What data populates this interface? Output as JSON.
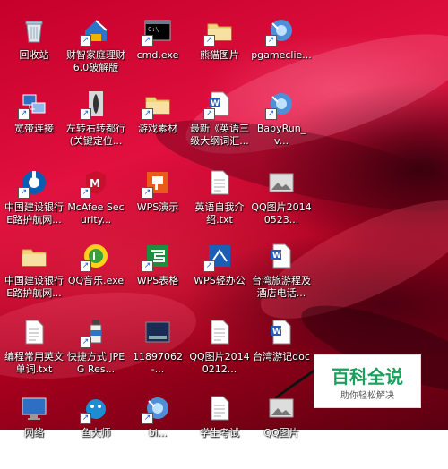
{
  "desktop": {
    "top_partial_label": "",
    "icons": [
      {
        "name": "recycle-bin",
        "icon": "recycle-bin-icon",
        "label": "回收站",
        "shortcut": false
      },
      {
        "name": "finance-software",
        "icon": "finance-house-icon",
        "label": "财智家庭理财6.0破解版",
        "shortcut": true
      },
      {
        "name": "cmd",
        "icon": "terminal-icon",
        "label": "cmd.exe",
        "shortcut": true
      },
      {
        "name": "panda-images",
        "icon": "folder-icon",
        "label": "熊猫图片",
        "shortcut": true
      },
      {
        "name": "pgameclient",
        "icon": "game-client-icon",
        "label": "pgameclie...",
        "shortcut": true
      },
      {
        "name": "broadband",
        "icon": "network-connection-icon",
        "label": "宽带连接",
        "shortcut": true
      },
      {
        "name": "left-right-game",
        "icon": "game-figure-icon",
        "label": "左转右转都行(关键定位...",
        "shortcut": true
      },
      {
        "name": "game-assets",
        "icon": "folder-icon",
        "label": "游戏素材",
        "shortcut": true
      },
      {
        "name": "latest-doc",
        "icon": "word-doc-icon",
        "label": "最新《英语三级大纲词汇...",
        "shortcut": true
      },
      {
        "name": "babyrun",
        "icon": "game-client-icon",
        "label": "BabyRun_v...",
        "shortcut": true
      },
      {
        "name": "ccb-guard",
        "icon": "ccb-bank-icon",
        "label": "中国建设银行E路护航网...",
        "shortcut": true
      },
      {
        "name": "mcafee",
        "icon": "mcafee-shield-icon",
        "label": "McAfee Security...",
        "shortcut": true
      },
      {
        "name": "wps-presentation",
        "icon": "wps-presentation-icon",
        "label": "WPS演示",
        "shortcut": true
      },
      {
        "name": "english-intro",
        "icon": "text-file-icon",
        "label": "英语自我介绍.txt",
        "shortcut": false
      },
      {
        "name": "qq-image-1",
        "icon": "image-file-icon",
        "label": "QQ图片20140523...",
        "shortcut": false
      },
      {
        "name": "ccb-folder",
        "icon": "folder-icon",
        "label": "中国建设银行E路护航网...",
        "shortcut": false
      },
      {
        "name": "qq-music",
        "icon": "qq-music-icon",
        "label": "QQ音乐.exe",
        "shortcut": true
      },
      {
        "name": "wps-spreadsheet",
        "icon": "wps-spreadsheet-icon",
        "label": "WPS表格",
        "shortcut": true
      },
      {
        "name": "wps-office",
        "icon": "wps-office-icon",
        "label": "WPS轻办公",
        "shortcut": true
      },
      {
        "name": "taiwan-travel",
        "icon": "word-doc-icon",
        "label": "台湾旅游程及酒店电话...",
        "shortcut": false
      },
      {
        "name": "english-words",
        "icon": "text-file-icon",
        "label": "编程常用英文单词.txt",
        "shortcut": false
      },
      {
        "name": "jpeg-shortcut",
        "icon": "bottle-icon",
        "label": "快捷方式 JPEG Res...",
        "shortcut": true
      },
      {
        "name": "img-11897062",
        "icon": "photo-thumb-icon",
        "label": "11897062-...",
        "shortcut": false
      },
      {
        "name": "qq-image-2",
        "icon": "text-file-icon",
        "label": "QQ图片20140212...",
        "shortcut": false
      },
      {
        "name": "taiwan-doc",
        "icon": "word-doc-icon",
        "label": "台湾游记doc",
        "shortcut": false
      },
      {
        "name": "network",
        "icon": "monitor-icon",
        "label": "网络",
        "shortcut": false
      },
      {
        "name": "app-6-2",
        "icon": "qq-pet-icon",
        "label": "鱼大师",
        "shortcut": true
      },
      {
        "name": "app-6-3",
        "icon": "game-client-icon",
        "label": "bi...",
        "shortcut": true
      },
      {
        "name": "app-6-4",
        "icon": "text-file-icon",
        "label": "学生考试",
        "shortcut": false
      },
      {
        "name": "app-6-5",
        "icon": "image-file-icon",
        "label": "QQ图片",
        "shortcut": false
      }
    ]
  },
  "watermark": {
    "title": "百科全说",
    "subtitle": "助你轻松解决"
  }
}
